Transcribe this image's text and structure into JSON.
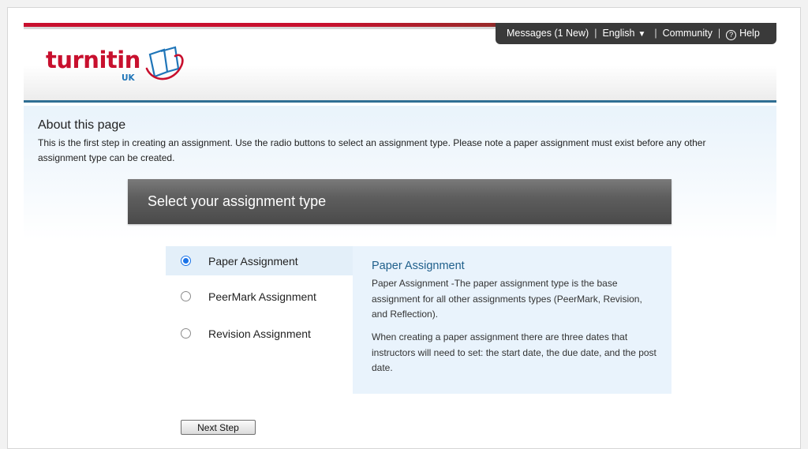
{
  "topbar": {
    "messages": "Messages (1 New)",
    "separator": "|",
    "language": "English",
    "language_caret": "▼",
    "community": "Community",
    "help_icon": "?",
    "help": "Help"
  },
  "logo": {
    "wordmark": "turnitin",
    "region": "UK",
    "icon": "turnitin-swoosh-icon"
  },
  "about": {
    "title": "About this page",
    "text": "This is the first step in creating an assignment. Use the radio buttons to select an assignment type. Please note a paper assignment must exist before any other assignment type can be created."
  },
  "select_header": "Select your assignment type",
  "options": [
    {
      "label": "Paper Assignment",
      "selected": true
    },
    {
      "label": "PeerMark Assignment",
      "selected": false
    },
    {
      "label": "Revision Assignment",
      "selected": false
    }
  ],
  "description": {
    "title": "Paper Assignment",
    "p1": "Paper Assignment -The paper assignment type is the base assignment for all other assignments types (PeerMark, Revision, and Reflection).",
    "p2": "When creating a paper assignment there are three dates that instructors will need to set: the start date, the due date, and the post date."
  },
  "next_button": "Next Step",
  "colors": {
    "brand_red": "#c8102e",
    "brand_blue": "#1f75b8",
    "header_rule": "#2f6e93",
    "topbar_bg": "#3a3a3a",
    "panel_bg": "#e9f3fc",
    "desc_title": "#1f5f8b"
  }
}
